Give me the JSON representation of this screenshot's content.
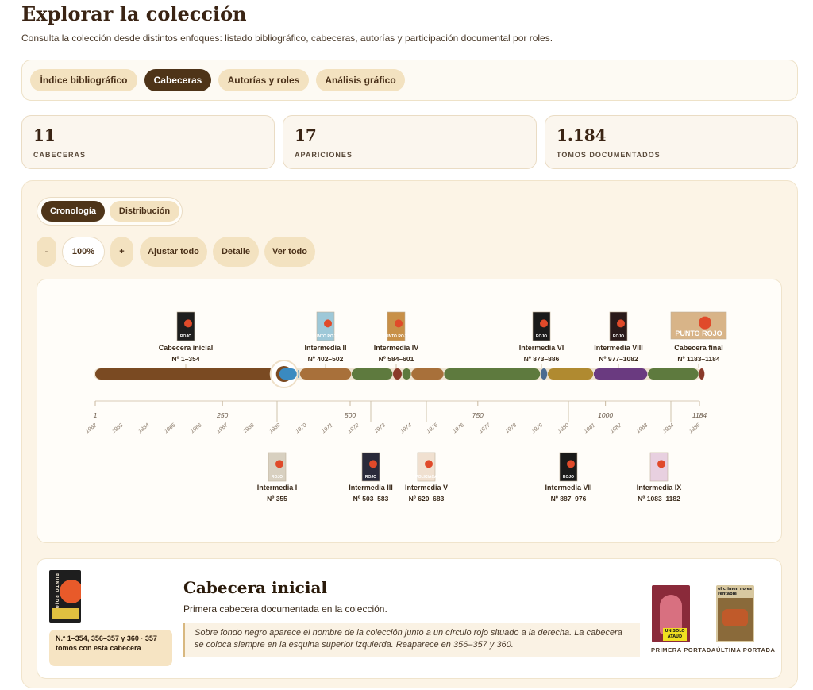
{
  "header": {
    "title": "Explorar la colección",
    "subtitle": "Consulta la colección desde distintos enfoques: listado bibliográfico, cabeceras, autorías y participación documental por roles."
  },
  "tabs": [
    {
      "label": "Índice bibliográfico",
      "active": false
    },
    {
      "label": "Cabeceras",
      "active": true
    },
    {
      "label": "Autorías y roles",
      "active": false
    },
    {
      "label": "Análisis gráfico",
      "active": false
    }
  ],
  "stats": [
    {
      "value": "11",
      "label": "CABECERAS"
    },
    {
      "value": "17",
      "label": "APARICIONES"
    },
    {
      "value": "1.184",
      "label": "TOMOS DOCUMENTADOS"
    }
  ],
  "view_toggle": {
    "chronology": "Cronología",
    "distribution": "Distribución",
    "active": "chronology"
  },
  "controls": {
    "zoom_out": "-",
    "zoom": "100%",
    "zoom_in": "+",
    "fit": "Ajustar todo",
    "detail": "Detalle",
    "see_all": "Ver todo"
  },
  "timeline": {
    "axis_ticks": [
      "1",
      "250",
      "500",
      "750",
      "1000",
      "1184"
    ],
    "years": [
      "1962",
      "1963",
      "1964",
      "1965",
      "1966",
      "1967",
      "1968",
      "1969",
      "1970",
      "1971",
      "1972",
      "1973",
      "1974",
      "1975",
      "1976",
      "1977",
      "1978",
      "1979",
      "1980",
      "1981",
      "1982",
      "1983",
      "1984",
      "1985"
    ],
    "segments": [
      {
        "from": 1,
        "to": 354,
        "color": "#7a4a22"
      },
      {
        "from": 355,
        "to": 401,
        "color": "#3a8ac0"
      },
      {
        "from": 402,
        "to": 502,
        "color": "#a8703a"
      },
      {
        "from": 503,
        "to": 583,
        "color": "#5e7a3e"
      },
      {
        "from": 584,
        "to": 601,
        "color": "#8a3a2a"
      },
      {
        "from": 602,
        "to": 619,
        "color": "#5e7a3e"
      },
      {
        "from": 620,
        "to": 683,
        "color": "#a8703a"
      },
      {
        "from": 684,
        "to": 872,
        "color": "#5e7a3e"
      },
      {
        "from": 873,
        "to": 886,
        "color": "#4a6a90"
      },
      {
        "from": 887,
        "to": 976,
        "color": "#b08a30"
      },
      {
        "from": 977,
        "to": 1082,
        "color": "#6a3a80"
      },
      {
        "from": 1083,
        "to": 1182,
        "color": "#5e7a3e"
      },
      {
        "from": 1183,
        "to": 1184,
        "color": "#8a3a2a"
      }
    ],
    "headings_top": [
      {
        "name": "Cabecera inicial",
        "range": "Nº 1–354",
        "cover_bg": "#1e1e1e",
        "cover_text": "ROJO"
      },
      {
        "name": "Intermedia II",
        "range": "Nº 402–502",
        "cover_bg": "#9ec8d8",
        "cover_text": "PUNTO ROJO"
      },
      {
        "name": "Intermedia IV",
        "range": "Nº 584–601",
        "cover_bg": "#c89048",
        "cover_text": "PUNTO ROJO"
      },
      {
        "name": "Intermedia VI",
        "range": "Nº 873–886",
        "cover_bg": "#1a1a1a",
        "cover_text": "ROJO"
      },
      {
        "name": "Intermedia VIII",
        "range": "Nº 977–1082",
        "cover_bg": "#2a1a1a",
        "cover_text": "ROJO"
      },
      {
        "name": "Cabecera final",
        "range": "Nº 1183–1184",
        "cover_bg": "#d8b488",
        "cover_text": "PUNTO ROJO"
      }
    ],
    "headings_bottom": [
      {
        "name": "Intermedia I",
        "range": "Nº 355",
        "cover_bg": "#d8d0c0",
        "cover_text": "ROJO"
      },
      {
        "name": "Intermedia III",
        "range": "Nº 503–583",
        "cover_bg": "#2a2a3a",
        "cover_text": "ROJO"
      },
      {
        "name": "Intermedia V",
        "range": "Nº 620–683",
        "cover_bg": "#f0e0d0",
        "cover_text": "POLICIACA"
      },
      {
        "name": "Intermedia VII",
        "range": "Nº 887–976",
        "cover_bg": "#1a1a1a",
        "cover_text": "ROJO"
      },
      {
        "name": "Intermedia IX",
        "range": "Nº 1083–1182",
        "cover_bg": "#e8d0e0",
        "cover_text": ""
      }
    ]
  },
  "detail": {
    "title": "Cabecera inicial",
    "subtitle": "Primera cabecera documentada en la colección.",
    "range_note": "N.º 1–354, 356–357 y 360 · 357 tomos con esta cabecera",
    "description": "Sobre fondo negro aparece el nombre de la colección junto a un círculo rojo situado a la derecha. La cabecera se coloca siempre en la esquina superior izquierda. Reaparece en 356–357 y 360.",
    "cover_text": "PUNTO ROJO",
    "first_cover_label": "PRIMERA PORTADA",
    "last_cover_label": "ÚLTIMA PORTADA",
    "first_cover_text": "UN SOLO ATAUD",
    "last_cover_text": "el crimen no es rentable"
  }
}
